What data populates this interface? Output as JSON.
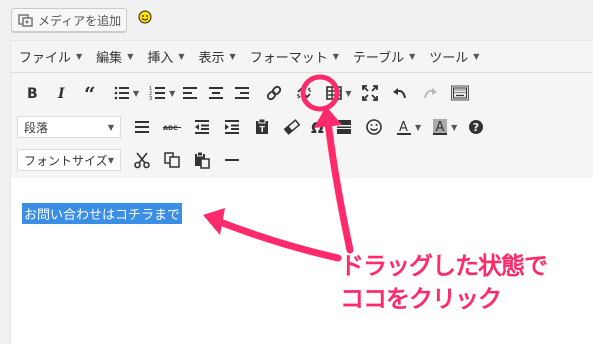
{
  "topbar": {
    "media_button_label": "メディアを追加"
  },
  "menubar": {
    "items": [
      {
        "label": "ファイル"
      },
      {
        "label": "編集"
      },
      {
        "label": "挿入"
      },
      {
        "label": "表示"
      },
      {
        "label": "フォーマット"
      },
      {
        "label": "テーブル"
      },
      {
        "label": "ツール"
      }
    ]
  },
  "toolbar": {
    "format_select": "段落",
    "fontsize_select": "フォントサイズ"
  },
  "content": {
    "selected_text": "お問い合わせはコチラまで"
  },
  "annotation": {
    "line1": "ドラッグした状態で",
    "line2": "ココをクリック",
    "color": "#ff2a6b"
  },
  "colors": {
    "selection": "#3a8ee6",
    "accent": "#ff2a6b"
  }
}
